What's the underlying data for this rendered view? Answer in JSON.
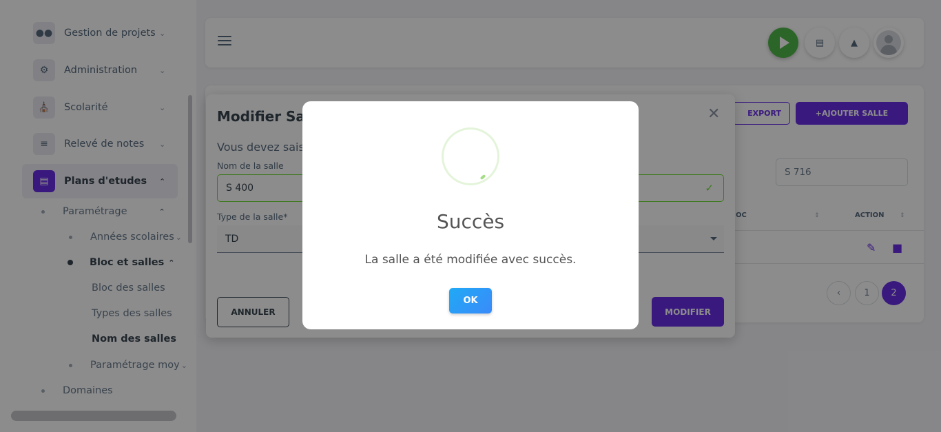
{
  "sidebar": {
    "menu": [
      {
        "label": "Gestion de projets",
        "icon": "users-icon"
      },
      {
        "label": "Administration",
        "icon": "user-gear-icon"
      },
      {
        "label": "Scolarité",
        "icon": "institution-icon"
      },
      {
        "label": "Relevé de notes",
        "icon": "list-edit-icon"
      },
      {
        "label": "Plans d'etudes",
        "icon": "document-icon"
      }
    ],
    "sub": {
      "parametrage": "Paramétrage",
      "annees": "Années scolaires",
      "bloc_et_salles": "Bloc et salles",
      "bloc_des_salles": "Bloc des salles",
      "types_des_salles": "Types des salles",
      "nom_des_salles": "Nom des salles",
      "parametrage_moy": "Paramétrage moy",
      "domaines": "Domaines"
    }
  },
  "toolbar": {
    "export_label": "EXPORT",
    "add_label": "+AJOUTER SALLE",
    "search_value": "S 716"
  },
  "table": {
    "col_bloc": "OC",
    "col_action": "ACTION"
  },
  "pagination": {
    "pages": [
      "1",
      "2"
    ],
    "current": "2"
  },
  "modal": {
    "title": "Modifier Salle",
    "subtitle": "Vous devez saisir",
    "name_label": "Nom de la salle",
    "name_value": "S 400",
    "type_label": "Type de la salle*",
    "type_value": "TD",
    "cancel_label": "ANNULER",
    "modify_label": "MODIFIER"
  },
  "dialog": {
    "title": "Succès",
    "message": "La salle a été modifiée avec succès.",
    "ok_label": "OK"
  },
  "colors": {
    "primary": "#6a2ee8",
    "success": "#71dd37",
    "play": "#51b84a",
    "ok_button": "#3a8bfa"
  }
}
